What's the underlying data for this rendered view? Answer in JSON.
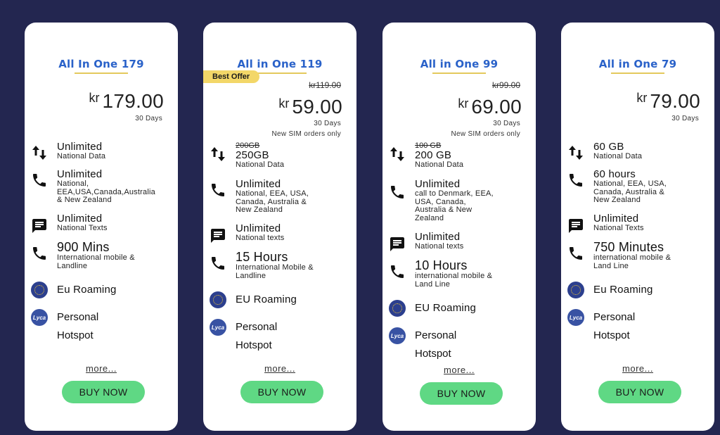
{
  "cards": [
    {
      "title": "All In One 179",
      "price_currency": "kr",
      "price_amount": "179.00",
      "days": "30 Days",
      "features": {
        "data_main": "Unlimited",
        "data_sub": "National Data",
        "calls_main": "Unlimited",
        "calls_sub": "National,\nEEA,USA,Canada,Australia\n& New Zealand",
        "texts_main": "Unlimited",
        "texts_sub": "National Texts",
        "intl_main": "900 Mins",
        "intl_sub": "International mobile &\nLandline",
        "roaming": "Eu Roaming",
        "hotspot_1": "Personal",
        "hotspot_2": "Hotspot"
      },
      "more": "more...",
      "buy": "BUY NOW"
    },
    {
      "title": "All in One 119",
      "badge": "Best Offer",
      "old_price": "kr119.00",
      "price_currency": "kr",
      "price_amount": "59.00",
      "days": "30 Days",
      "note": "New SIM orders only",
      "features": {
        "data_strike": "200GB",
        "data_main": "250GB",
        "data_sub": "National Data",
        "calls_main": "Unlimited",
        "calls_sub": "National, EEA, USA,\nCanada, Australia &\nNew Zealand",
        "texts_main": "Unlimited",
        "texts_sub": "National texts",
        "intl_main": "15 Hours",
        "intl_sub": "International Mobile &\nLandline",
        "roaming": "EU Roaming",
        "hotspot_1": "Personal",
        "hotspot_2": "Hotspot"
      },
      "more": "more...",
      "buy": "BUY NOW"
    },
    {
      "title": "All in One 99",
      "old_price": "kr99.00",
      "price_currency": "kr",
      "price_amount": "69.00",
      "days": "30 Days",
      "note": "New SIM orders only",
      "features": {
        "data_strike": "100 GB",
        "data_main": "200 GB",
        "data_sub": "National Data",
        "calls_main": "Unlimited",
        "calls_sub": "call to Denmark, EEA,\nUSA, Canada,\nAustralia & New\nZealand",
        "texts_main": "Unlimited",
        "texts_sub": "National texts",
        "intl_main": "10 Hours",
        "intl_sub": "international mobile &\nLand Line",
        "roaming": "EU Roaming",
        "hotspot_1": "Personal",
        "hotspot_2": "Hotspot"
      },
      "more": "more...",
      "buy": "BUY NOW"
    },
    {
      "title": "All in One 79",
      "price_currency": "kr",
      "price_amount": "79.00",
      "days": "30 Days",
      "features": {
        "data_main": "60 GB",
        "data_sub": "National Data",
        "calls_main": "60 hours",
        "calls_sub": "National, EEA, USA,\nCanada, Australia &\nNew Zealand",
        "texts_main": "Unlimited",
        "texts_sub": "National Texts",
        "intl_main": "750 Minutes",
        "intl_sub": "international mobile &\nLand Line",
        "roaming": "Eu Roaming",
        "hotspot_1": "Personal",
        "hotspot_2": "Hotspot"
      },
      "more": "more...",
      "buy": "BUY NOW"
    }
  ],
  "icons": {
    "data": "data-transfer-icon",
    "calls": "phone-icon",
    "texts": "message-icon",
    "intl": "phone-icon",
    "roaming": "eu-flag-icon",
    "hotspot": "lyca-hotspot-icon"
  },
  "icon_labels": {
    "lyca": "Lyca"
  },
  "colors": {
    "background": "#232650",
    "title": "#2a62c9",
    "buy_button": "#5fd884",
    "badge": "#f3d768"
  }
}
